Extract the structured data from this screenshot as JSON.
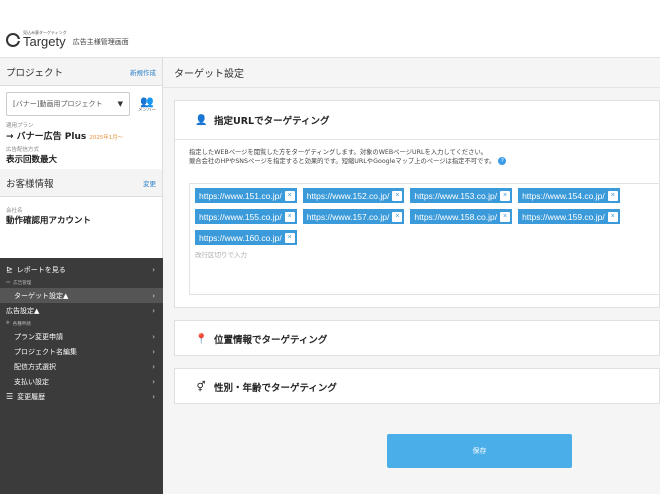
{
  "header": {
    "logo_sub": "見込み客ターゲティング",
    "logo_name": "Targety",
    "logo_tag": "広告主様管理画面"
  },
  "sidebar": {
    "project_title": "プロジェクト",
    "new_link": "新規作成",
    "project_select": "[バナー]動画用プロジェクト",
    "member_label": "メンバー",
    "plan_label": "適用プラン",
    "plan_value": "→ バナー広告 Plus",
    "plan_since": "2025年1月〜",
    "dist_label": "広告配信方式",
    "dist_value": "表示回数最大",
    "customer_title": "お客様情報",
    "change_link": "変更",
    "company_label": "会社名",
    "company_value": "動作確認用アカウント"
  },
  "nav": {
    "report": "レポートを見る",
    "group_ads": "広告管理",
    "target": "ターゲット設定▲",
    "ad_settings": "広告設定▲",
    "group_apply": "各種申請",
    "plan_change": "プラン変更申請",
    "project_name": "プロジェクト名編集",
    "dist_select": "配信方式選択",
    "payment": "支払い設定",
    "history": "変更履歴"
  },
  "main": {
    "title": "ターゲット設定",
    "url_card_title": "指定URLでターゲティング",
    "desc_line1": "指定したWEBページを閲覧した方をターゲティングします。対象のWEBページURLを入力してください。",
    "desc_line2": "競合会社のHPやSNSページを指定すると効果的です。短縮URLやGoogleマップ上のページは指定不可です。",
    "urls": [
      "https://www.151.co.jp/",
      "https://www.152.co.jp/",
      "https://www.153.co.jp/",
      "https://www.154.co.jp/",
      "https://www.155.co.jp/",
      "https://www.157.co.jp/",
      "https://www.158.co.jp/",
      "https://www.159.co.jp/",
      "https://www.160.co.jp/"
    ],
    "tag_placeholder": "改行区切りで入力",
    "location_title": "位置情報でターゲティング",
    "gender_title": "性別・年齢でターゲティング",
    "save_label": "保存"
  },
  "colors": {
    "accent": "#3b9ad9",
    "save": "#4aaee8",
    "nav_bg": "#3b3b3b",
    "plan_since": "#e8903a"
  }
}
